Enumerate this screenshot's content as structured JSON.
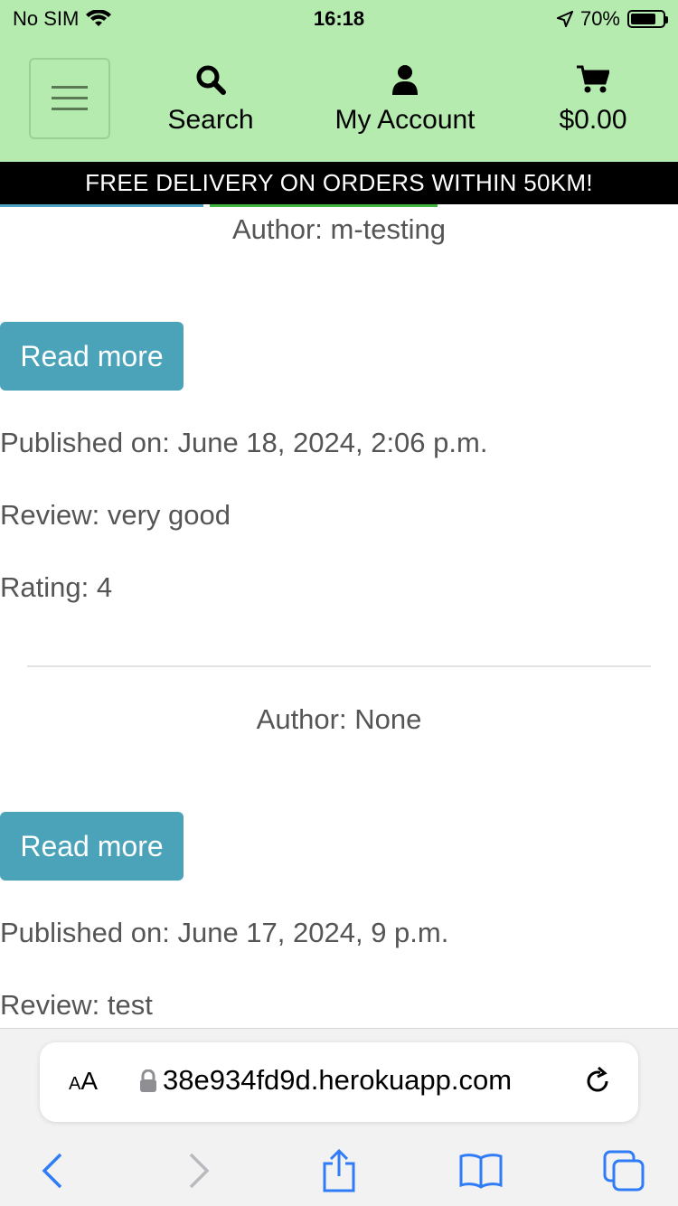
{
  "status_bar": {
    "carrier": "No SIM",
    "time": "16:18",
    "battery": "70%",
    "battery_level": 0.7
  },
  "header": {
    "search_label": "Search",
    "account_label": "My Account",
    "cart_total": "$0.00",
    "banner": "FREE DELIVERY ON ORDERS WITHIN 50KM!",
    "colors": {
      "header_bg": "#b6ebb0",
      "banner_bg": "#000000",
      "button_bg": "#4aa3b8"
    }
  },
  "reviews": [
    {
      "author": "Author: m-testing",
      "read_more": "Read more",
      "published": "Published on: June 18, 2024, 2:06 p.m.",
      "review": "Review: very good",
      "rating": "Rating: 4"
    },
    {
      "author": "Author: None",
      "read_more": "Read more",
      "published": "Published on: June 17, 2024, 9 p.m.",
      "review": "Review: test"
    }
  ],
  "browser": {
    "aa_label_small": "A",
    "aa_label_large": "A",
    "url": "38e934fd9d.herokuapp.com"
  },
  "icons": [
    "hamburger-icon",
    "search-icon",
    "user-icon",
    "cart-icon",
    "lock-icon",
    "reload-icon",
    "back-icon",
    "forward-icon",
    "share-icon",
    "bookmarks-icon",
    "tabs-icon",
    "wifi-icon",
    "location-icon"
  ]
}
